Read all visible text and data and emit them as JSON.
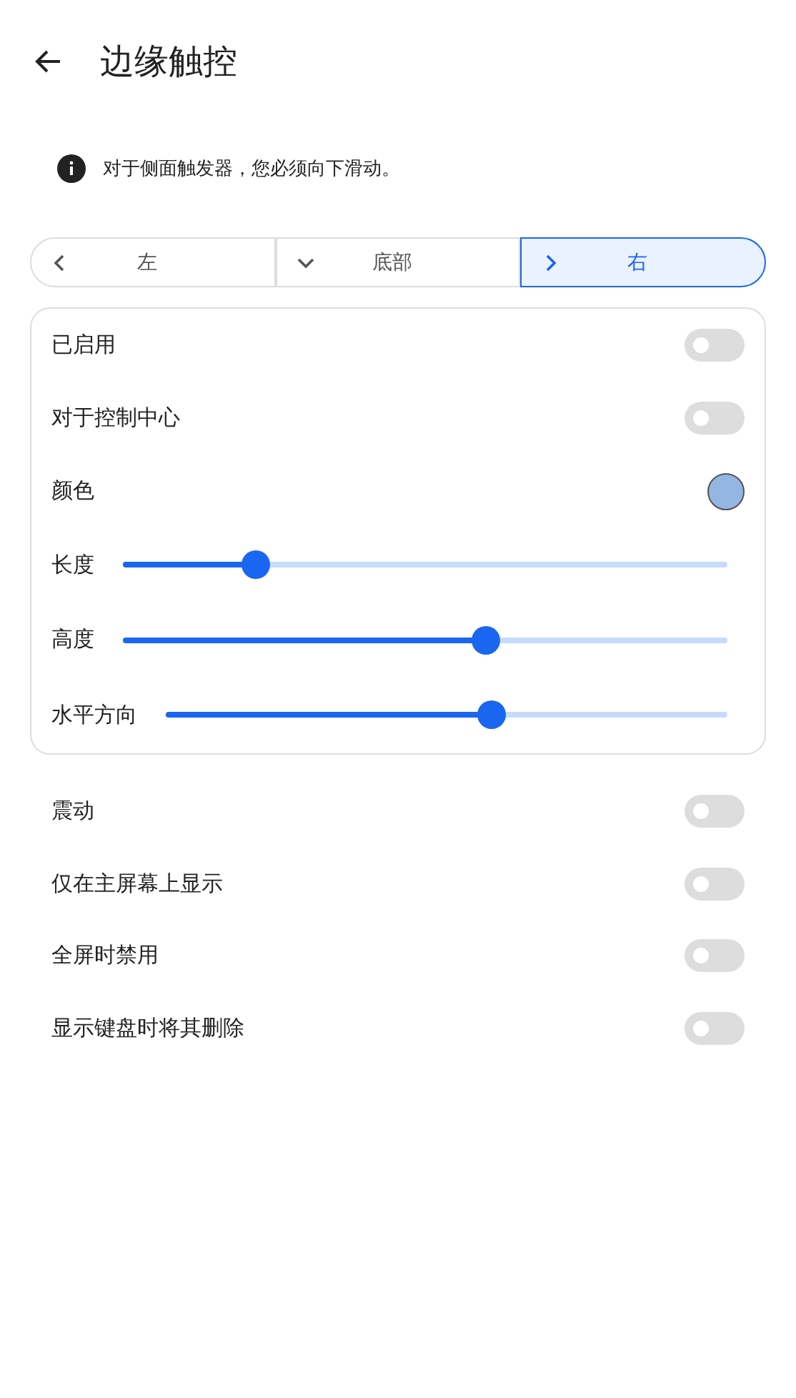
{
  "header": {
    "title": "边缘触控"
  },
  "notice": {
    "text": "对于侧面触发器，您必须向下滑动。"
  },
  "tabs": [
    {
      "label": "左",
      "kind": "left",
      "selected": false
    },
    {
      "label": "底部",
      "kind": "down",
      "selected": false
    },
    {
      "label": "右",
      "kind": "right",
      "selected": true
    }
  ],
  "card": [
    {
      "kind": "toggle",
      "label": "已启用",
      "on": false
    },
    {
      "kind": "toggle",
      "label": "对于控制中心",
      "on": false
    },
    {
      "kind": "color",
      "label": "颜色",
      "color": "#94b6e2"
    },
    {
      "kind": "slider",
      "label": "长度",
      "level": 0.22
    },
    {
      "kind": "slider",
      "label": "高度",
      "level": 0.6
    },
    {
      "kind": "slider",
      "label": "水平方向",
      "level": 0.58
    }
  ],
  "settings": [
    {
      "label": "震动",
      "on": false
    },
    {
      "label": "仅在主屏幕上显示",
      "on": false
    },
    {
      "label": "全屏时禁用",
      "on": false
    },
    {
      "label": "显示键盘时将其删除",
      "on": false
    }
  ]
}
